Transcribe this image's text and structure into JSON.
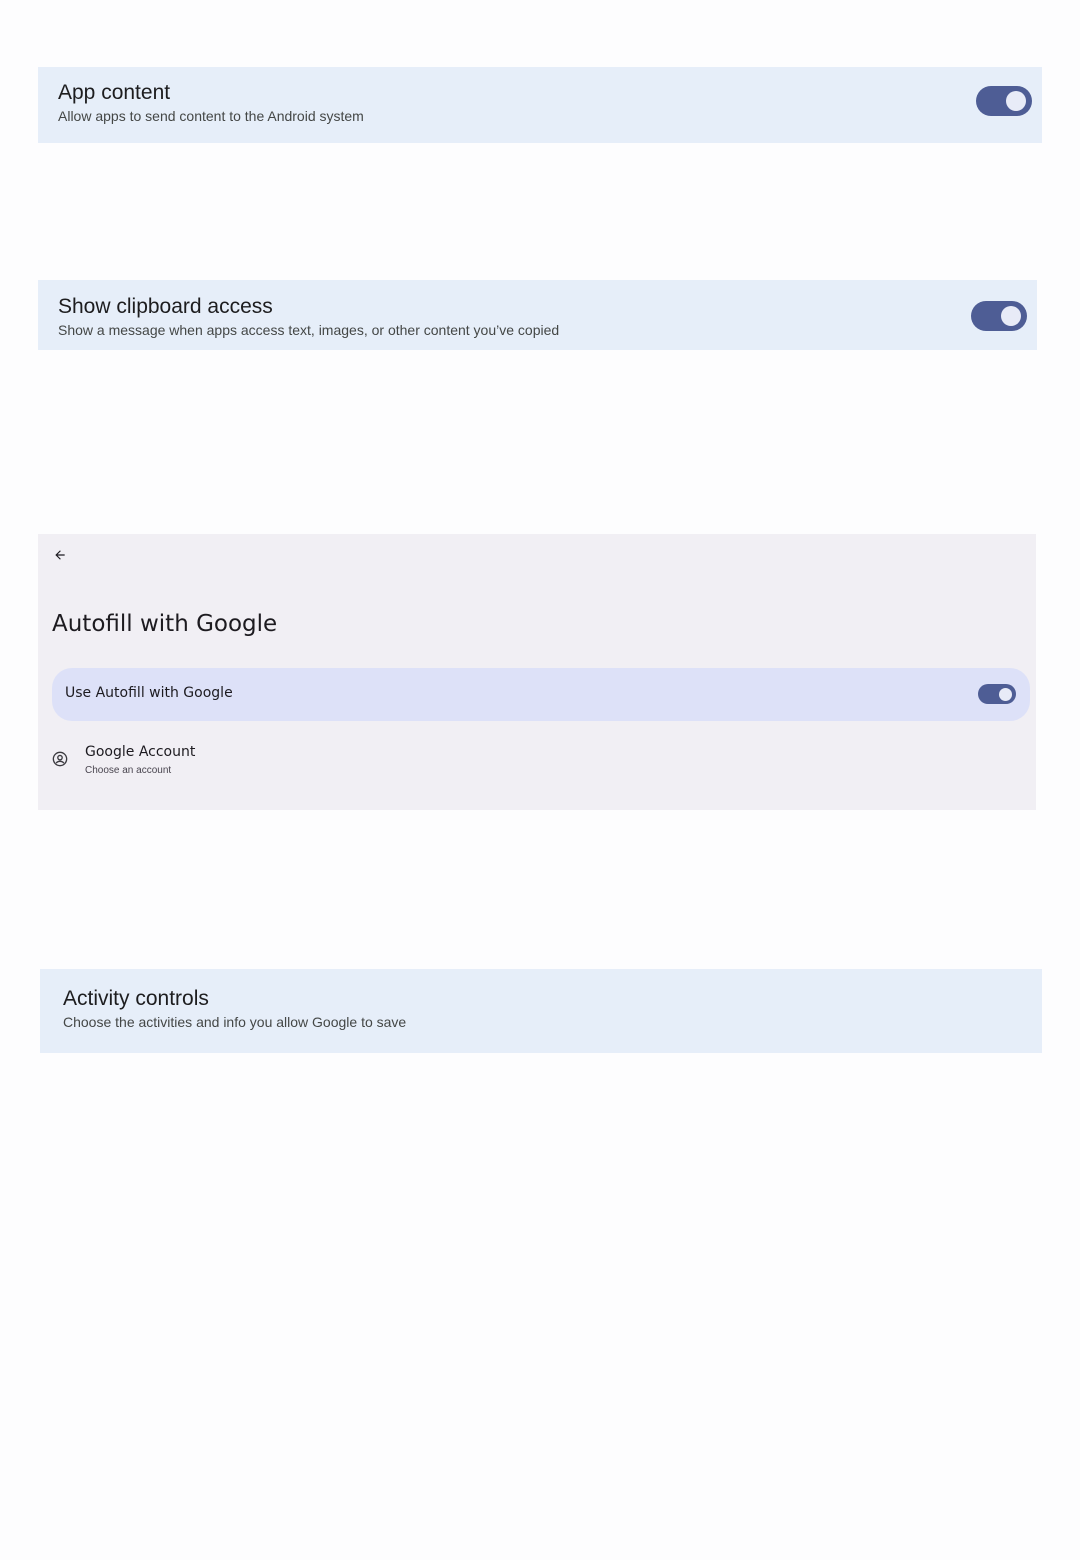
{
  "app_content": {
    "title": "App content",
    "subtitle": "Allow apps to send content to the Android system",
    "toggle_on": true
  },
  "clipboard": {
    "title": "Show clipboard access",
    "subtitle": "Show a message when apps access text, images, or other content you’ve copied",
    "toggle_on": true
  },
  "autofill": {
    "back_icon": "arrow-back-icon",
    "title": "Autofill with Google",
    "use_autofill_label": "Use Autofill with Google",
    "use_autofill_on": true,
    "account_icon": "account-circle-icon",
    "account_title": "Google Account",
    "account_subtitle": "Choose an account"
  },
  "activity": {
    "title": "Activity controls",
    "subtitle": "Choose the activities and info you allow Google to save"
  },
  "colors": {
    "card_blue": "#e6eef9",
    "toggle_track": "#4e5d95",
    "autofill_bg": "#f1eff4",
    "autofill_row": "#dde1f8"
  }
}
